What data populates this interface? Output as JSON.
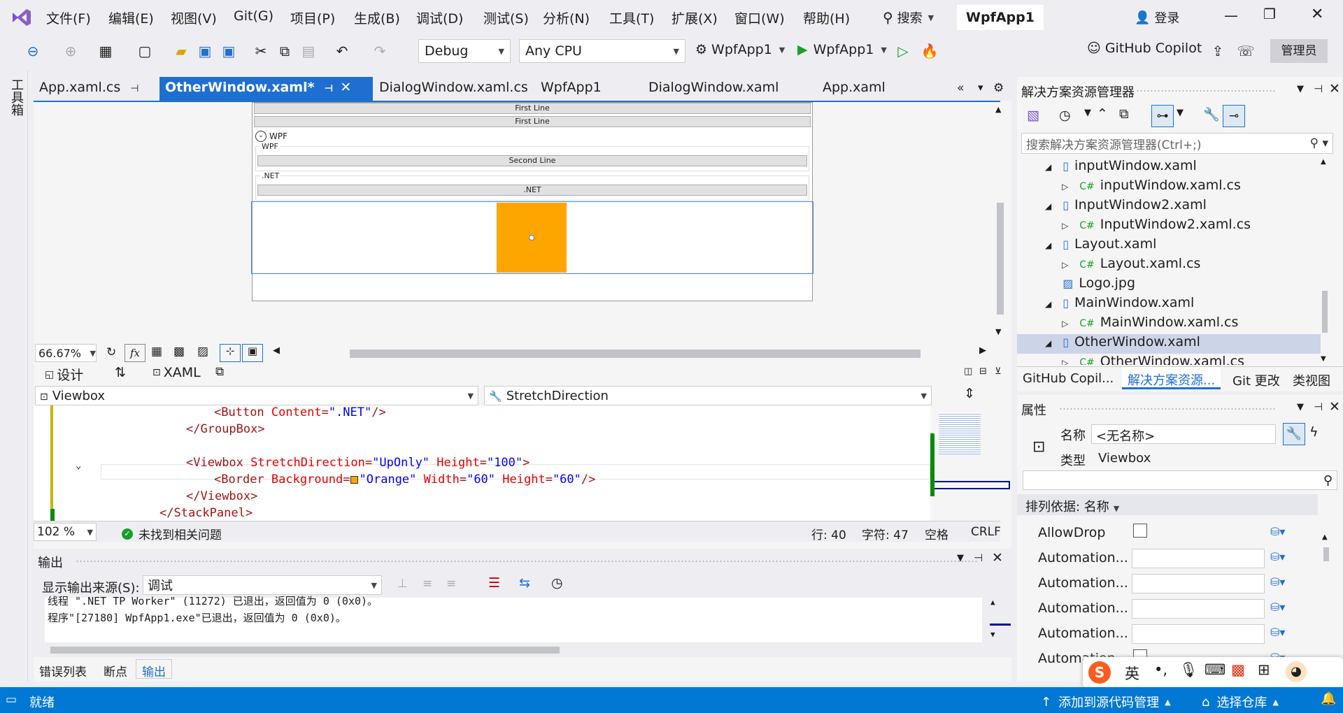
{
  "menubar": {
    "items": [
      "文件(F)",
      "编辑(E)",
      "视图(V)",
      "Git(G)",
      "项目(P)",
      "生成(B)",
      "调试(D)",
      "测试(S)",
      "分析(N)",
      "工具(T)",
      "扩展(X)",
      "窗口(W)",
      "帮助(H)"
    ],
    "search": "搜索",
    "solution_name": "WpfApp1",
    "login": "登录"
  },
  "toolbar": {
    "config": "Debug",
    "platform": "Any CPU",
    "startup": "WpfApp1",
    "run_target": "WpfApp1",
    "copilot": "GitHub Copilot",
    "admin": "管理员"
  },
  "toolwindow_tab": "工具箱",
  "tabs": [
    "App.xaml.cs",
    "OtherWindow.xaml*",
    "DialogWindow.xaml.cs",
    "WpfApp1",
    "DialogWindow.xaml",
    "App.xaml"
  ],
  "designer": {
    "first_line_1": "First Line",
    "first_line_2": "First Line",
    "expander_header": "WPF",
    "group1_header": "WPF",
    "second_line": "Second Line",
    "group2_header": ".NET",
    "net_button": ".NET",
    "zoom": "66.67%"
  },
  "view_tabs": {
    "design": "设计",
    "swap": "⇅",
    "xaml": "XAML"
  },
  "nav": {
    "element": "Viewbox",
    "member": "StretchDirection"
  },
  "code_lines": [
    {
      "indent": "        ",
      "parts": [
        [
          "brk",
          "<"
        ],
        [
          "tag",
          "Button "
        ],
        [
          "attr",
          "Content"
        ],
        [
          "brk",
          "="
        ],
        [
          "val",
          "\".NET\""
        ],
        [
          "brk",
          "/>"
        ]
      ]
    },
    {
      "indent": "    ",
      "parts": [
        [
          "brk",
          "</"
        ],
        [
          "tag",
          "GroupBox"
        ],
        [
          "brk",
          ">"
        ]
      ]
    },
    {
      "indent": "",
      "parts": []
    },
    {
      "indent": "    ",
      "parts": [
        [
          "brk",
          "<"
        ],
        [
          "tag",
          "Viewbox "
        ],
        [
          "attr",
          "StretchDirection"
        ],
        [
          "brk",
          "="
        ],
        [
          "val",
          "\"UpOnly\" "
        ],
        [
          "attr",
          "Height"
        ],
        [
          "brk",
          "="
        ],
        [
          "val",
          "\"100\""
        ],
        [
          "brk",
          ">"
        ]
      ]
    },
    {
      "indent": "        ",
      "parts": [
        [
          "brk",
          "<"
        ],
        [
          "tag",
          "Border "
        ],
        [
          "attr",
          "Background"
        ],
        [
          "brk",
          "="
        ],
        [
          "val",
          "\"Orange\" "
        ],
        [
          "attr",
          "Width"
        ],
        [
          "brk",
          "="
        ],
        [
          "val",
          "\"60\" "
        ],
        [
          "attr",
          "Height"
        ],
        [
          "brk",
          "="
        ],
        [
          "val",
          "\"60\""
        ],
        [
          "brk",
          "/>"
        ]
      ]
    },
    {
      "indent": "    ",
      "parts": [
        [
          "brk",
          "</"
        ],
        [
          "tag",
          "Viewbox"
        ],
        [
          "brk",
          ">"
        ]
      ]
    },
    {
      "indent": "",
      "parts": [
        [
          "brk",
          "</"
        ],
        [
          "tag",
          "StackPanel"
        ],
        [
          "brk",
          ">"
        ]
      ]
    }
  ],
  "editor_status": {
    "zoom": "102 %",
    "issues": "未找到相关问题",
    "line": "行: 40",
    "char": "字符: 47",
    "spaces": "空格",
    "eol": "CRLF"
  },
  "output": {
    "title": "输出",
    "source_label": "显示输出来源(S):",
    "source_value": "调试",
    "lines": [
      "线程 \".NET TP Worker\" (11272) 已退出，返回值为 0 (0x0)。",
      "程序\"[27180] WpfApp1.exe\"已退出，返回值为 0 (0x0)。"
    ]
  },
  "bottom_tabs": [
    "错误列表",
    "断点",
    "输出"
  ],
  "solution_explorer": {
    "title": "解决方案资源管理器",
    "search_placeholder": "搜索解决方案资源管理器(Ctrl+;)",
    "items": [
      {
        "label": "inputWindow.xaml",
        "kind": "xaml",
        "depth": 0,
        "expanded": true
      },
      {
        "label": "inputWindow.xaml.cs",
        "kind": "cs",
        "depth": 1,
        "expanded": false
      },
      {
        "label": "InputWindow2.xaml",
        "kind": "xaml",
        "depth": 0,
        "expanded": true
      },
      {
        "label": "InputWindow2.xaml.cs",
        "kind": "cs",
        "depth": 1,
        "expanded": false
      },
      {
        "label": "Layout.xaml",
        "kind": "xaml",
        "depth": 0,
        "expanded": true
      },
      {
        "label": "Layout.xaml.cs",
        "kind": "cs",
        "depth": 1,
        "expanded": false
      },
      {
        "label": "Logo.jpg",
        "kind": "img",
        "depth": 0,
        "expanded": false
      },
      {
        "label": "MainWindow.xaml",
        "kind": "xaml",
        "depth": 0,
        "expanded": true
      },
      {
        "label": "MainWindow.xaml.cs",
        "kind": "cs",
        "depth": 1,
        "expanded": false
      },
      {
        "label": "OtherWindow.xaml",
        "kind": "xaml",
        "depth": 0,
        "expanded": true,
        "selected": true
      },
      {
        "label": "OtherWindow.xaml.cs",
        "kind": "cs",
        "depth": 1,
        "expanded": false
      }
    ],
    "tabs": [
      "GitHub Copil...",
      "解决方案资源...",
      "Git 更改",
      "类视图"
    ]
  },
  "properties": {
    "title": "属性",
    "name_label": "名称",
    "name_value": "<无名称>",
    "type_label": "类型",
    "type_value": "Viewbox",
    "sort_label": "排列依据: 名称",
    "rows": [
      {
        "label": "AllowDrop",
        "kind": "check"
      },
      {
        "label": "Automation...",
        "kind": "text"
      },
      {
        "label": "Automation...",
        "kind": "text"
      },
      {
        "label": "Automation...",
        "kind": "text"
      },
      {
        "label": "Automation...",
        "kind": "text"
      },
      {
        "label": "Automation...",
        "kind": "check"
      }
    ]
  },
  "ime": {
    "lang": "英"
  },
  "statusbar": {
    "ready": "就绪",
    "source_control": "添加到源代码管理",
    "repo": "选择仓库"
  },
  "colors": {
    "accent": "#0078d4",
    "orange": "#ffa500",
    "tab_active": "#1f6fd0"
  }
}
